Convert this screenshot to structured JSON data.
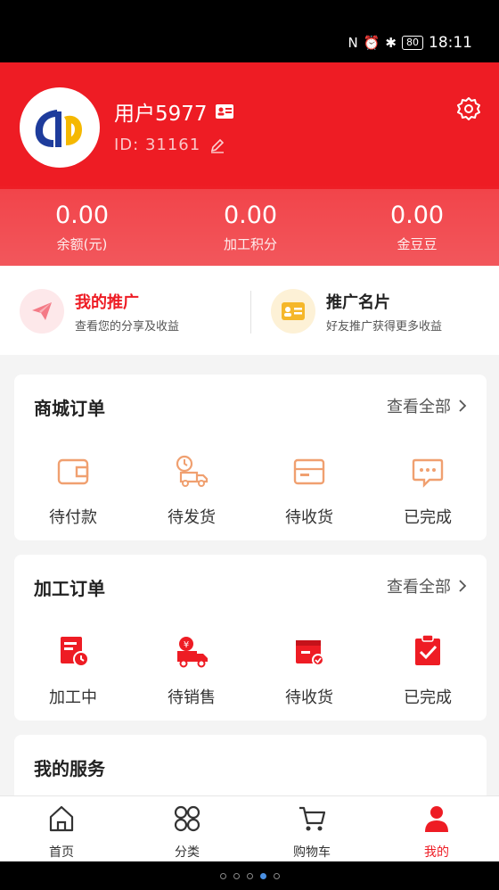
{
  "status_bar": {
    "battery": "80",
    "time": "18:11"
  },
  "profile": {
    "username": "用户5977",
    "id_label": "ID: 31161"
  },
  "stats": [
    {
      "value": "0.00",
      "label": "余额(元)"
    },
    {
      "value": "0.00",
      "label": "加工积分"
    },
    {
      "value": "0.00",
      "label": "金豆豆"
    }
  ],
  "promo": {
    "left": {
      "title": "我的推广",
      "subtitle": "查看您的分享及收益"
    },
    "right": {
      "title": "推广名片",
      "subtitle": "好友推广获得更多收益"
    }
  },
  "mall_orders": {
    "title": "商城订单",
    "more": "查看全部",
    "items": [
      {
        "label": "待付款",
        "icon": "wallet-icon"
      },
      {
        "label": "待发货",
        "icon": "delivery-truck-icon"
      },
      {
        "label": "待收货",
        "icon": "package-icon"
      },
      {
        "label": "已完成",
        "icon": "chat-bubble-icon"
      }
    ]
  },
  "process_orders": {
    "title": "加工订单",
    "more": "查看全部",
    "items": [
      {
        "label": "加工中",
        "icon": "document-clock-icon"
      },
      {
        "label": "待销售",
        "icon": "sale-truck-icon"
      },
      {
        "label": "待收货",
        "icon": "receive-box-icon"
      },
      {
        "label": "已完成",
        "icon": "clipboard-check-icon"
      }
    ]
  },
  "services": {
    "title": "我的服务"
  },
  "bottom_nav": [
    {
      "label": "首页",
      "icon": "home-icon"
    },
    {
      "label": "分类",
      "icon": "category-icon"
    },
    {
      "label": "购物车",
      "icon": "cart-icon"
    },
    {
      "label": "我的",
      "icon": "user-icon"
    }
  ],
  "colors": {
    "brand_red": "#ee1c24",
    "icon_peach": "#f0a070"
  }
}
